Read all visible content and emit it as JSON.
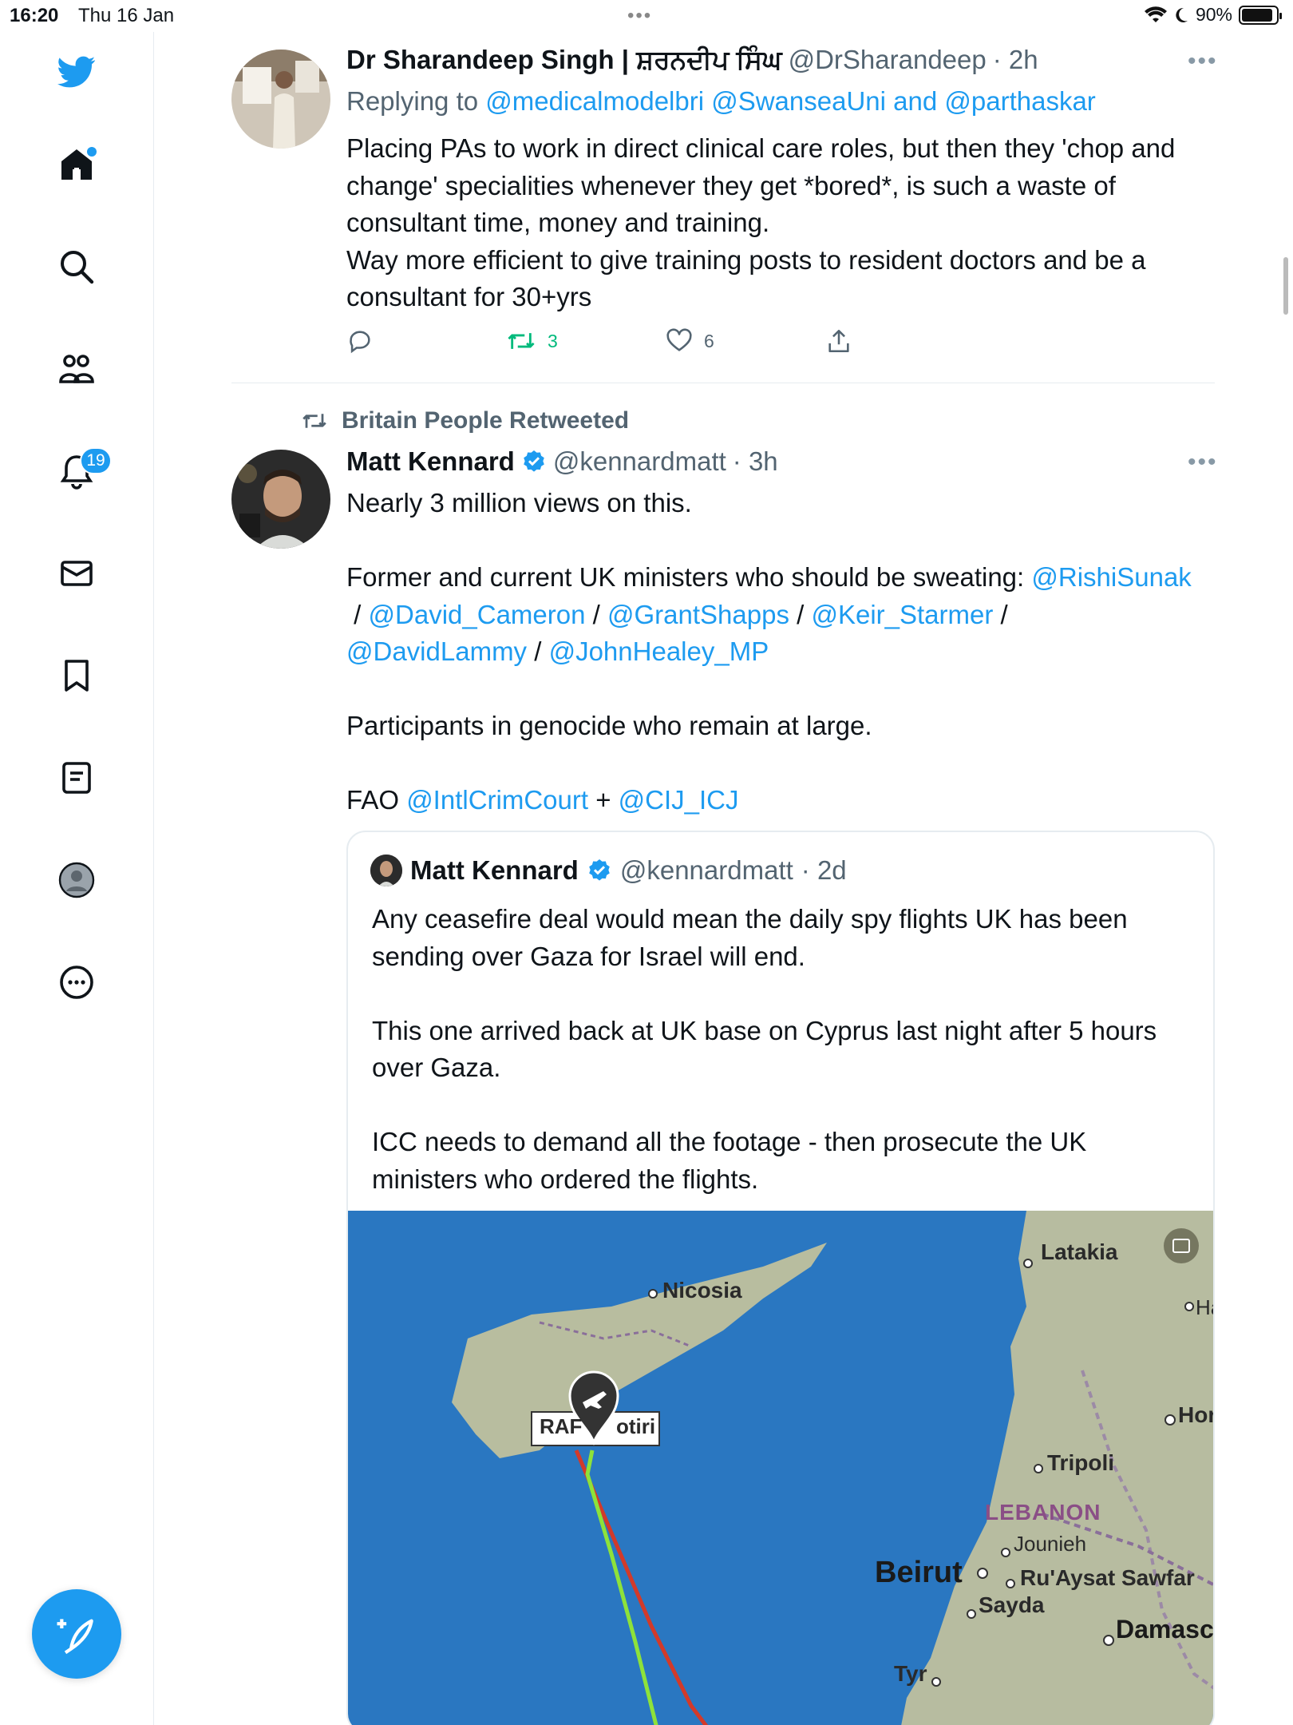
{
  "status_bar": {
    "time": "16:20",
    "date": "Thu 16 Jan",
    "battery": "90%"
  },
  "sidebar": {
    "notifications_badge": "19",
    "items": [
      "twitter-logo",
      "home",
      "explore",
      "communities",
      "notifications",
      "messages",
      "bookmarks",
      "lists",
      "profile",
      "more"
    ]
  },
  "tweet1": {
    "name": "Dr Sharandeep Singh | ਸ਼ਰਨਦੀਪ ਸਿੰਘ",
    "handle": "@DrSharandeep",
    "time": "· 2h",
    "replying_prefix": "Replying to",
    "replying_targets": "@medicalmodelbri @SwanseaUni and @parthaskar",
    "text": "Placing PAs to work in direct clinical care roles, but then they 'chop and change' specialities whenever they get *bored*, is such a waste of consultant time, money and training.\nWay more efficient to give training posts to resident doctors and be a consultant for 30+yrs",
    "retweets": "3",
    "likes": "6"
  },
  "retweet_context": "Britain People Retweeted",
  "tweet2": {
    "name": "Matt Kennard",
    "handle": "@kennardmatt",
    "time": "· 3h",
    "line1": "Nearly 3 million views on this.",
    "line2_prefix": "Former and current UK ministers who should be sweating: ",
    "mentions": [
      "@RishiSunak",
      "@David_Cameron",
      "@GrantShapps",
      "@Keir_Starmer",
      "@DavidLammy",
      "@JohnHealey_MP"
    ],
    "sep": " / ",
    "line3": "Participants in genocide who remain at large.",
    "fao_prefix": "FAO ",
    "fao_1": "@IntlCrimCourt",
    "fao_plus": " + ",
    "fao_2": "@CIJ_ICJ"
  },
  "quote": {
    "name": "Matt Kennard",
    "handle": "@kennardmatt",
    "time": "· 2d",
    "p1": "Any ceasefire deal would mean the daily spy flights UK has been sending over Gaza for Israel will end.",
    "p2": "This one arrived back at UK base on Cyprus last night after 5 hours over Gaza.",
    "p3": "ICC needs to demand all the footage - then prosecute the UK ministers who ordered the flights."
  },
  "map": {
    "labels": {
      "latakia": "Latakia",
      "nicosia": "Nicosia",
      "raf": "RAF",
      "otiri": "otiri",
      "ha": "Ha",
      "hor": "Hor",
      "tripoli": "Tripoli",
      "lebanon": "LEBANON",
      "jounieh": "Jounieh",
      "beirut": "Beirut",
      "ruaysat": "Ru'Aysat Sawfar",
      "sayda": "Sayda",
      "damasc": "Damasc",
      "tyr": "Tyr"
    },
    "colors": {
      "sea": "#2a77c1",
      "land": "#b7bca0",
      "track_red": "#d23a2a",
      "track_green": "#8ee23a"
    }
  },
  "colors": {
    "accent": "#1d9bf0",
    "retweet_green": "#00ba7c",
    "muted": "#536471"
  }
}
